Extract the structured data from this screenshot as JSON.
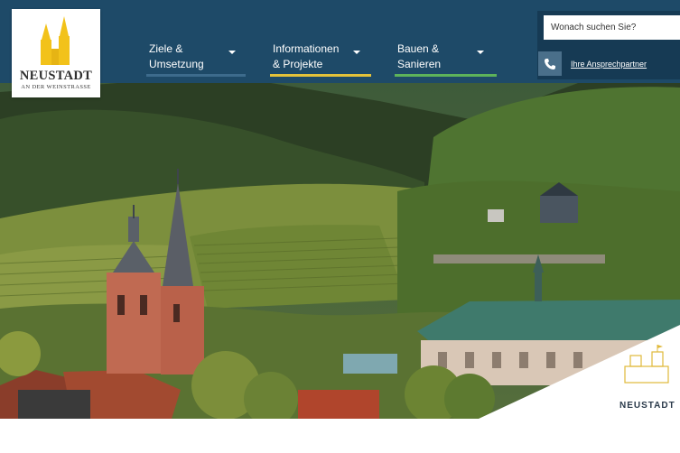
{
  "logo": {
    "name": "NEUSTADT",
    "subtitle": "AN DER WEINSTRASSE"
  },
  "nav": [
    {
      "label": "Ziele &\nUmsetzung",
      "accent": "#3d6b8c"
    },
    {
      "label": "Informationen\n& Projekte",
      "accent": "#e4c23a"
    },
    {
      "label": "Bauen &\nSanieren",
      "accent": "#5db35a"
    }
  ],
  "search": {
    "placeholder": "Wonach suchen Sie?"
  },
  "contact": {
    "icon": "phone-icon",
    "label": "Ihre Ansprechpartner"
  },
  "corner_logo": {
    "text": "NEUSTADT"
  },
  "colors": {
    "header": "#1e4a68",
    "search_panel": "#163a54"
  }
}
